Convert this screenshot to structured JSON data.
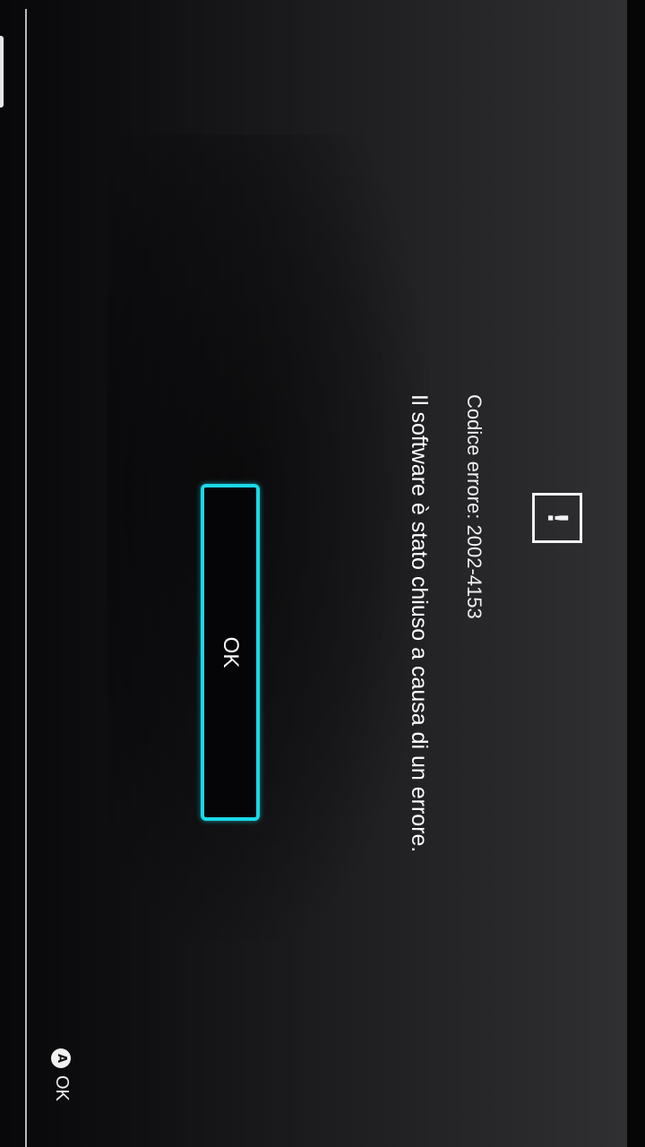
{
  "dialog": {
    "icon": "exclamation-icon",
    "error_code": "Codice errore: 2002-4153",
    "message": "Il software è stato chiuso a causa di un errore.",
    "ok_label": "OK"
  },
  "footer": {
    "button_glyph": "A",
    "hint_label": "OK"
  },
  "colors": {
    "accent": "#1ad8e8",
    "text": "#ffffff",
    "background": "#1a1a1d"
  }
}
